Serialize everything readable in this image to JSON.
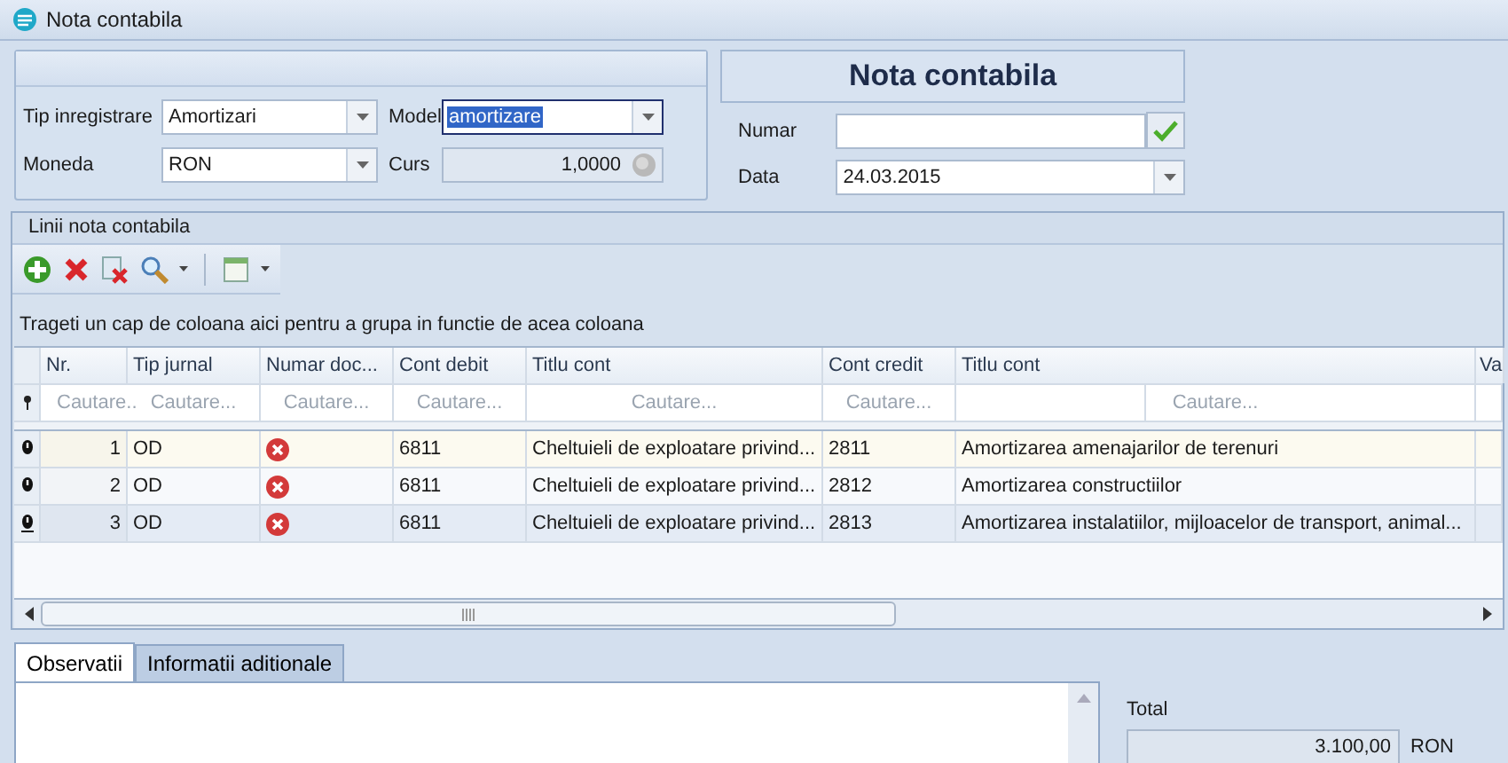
{
  "window": {
    "title": "Nota contabila"
  },
  "header_form": {
    "fields": [
      {
        "label": "Tip inregistrare",
        "value": "Amortizari",
        "kind": "combo",
        "highlighted": false
      },
      {
        "label": "Model",
        "value": "amortizare",
        "kind": "combo",
        "highlighted": true
      },
      {
        "label": "Moneda",
        "value": "RON",
        "kind": "combo",
        "highlighted": false
      },
      {
        "label": "Curs",
        "value": "1,0000",
        "kind": "readonly",
        "highlighted": false
      }
    ]
  },
  "document": {
    "title": "Nota contabila",
    "numar": {
      "label": "Numar"
    },
    "data": {
      "label": "Data",
      "value": "24.03.2015"
    }
  },
  "lines": {
    "caption": "Linii nota contabila",
    "group_hint": "Trageti un cap de coloana aici pentru a grupa in functie de acea coloana",
    "columns": [
      {
        "title": "Nr.",
        "filter": "Cautare.."
      },
      {
        "title": "Tip jurnal",
        "filter": "Cautare..."
      },
      {
        "title": "Numar doc...",
        "filter": "Cautare..."
      },
      {
        "title": "Cont debit",
        "filter": "Cautare..."
      },
      {
        "title": "Titlu cont",
        "filter": "Cautare..."
      },
      {
        "title": "Cont credit",
        "filter": "Cautare..."
      },
      {
        "title": "Titlu cont",
        "filter": "Cautare..."
      },
      {
        "title": "Va"
      }
    ],
    "rows": [
      {
        "nr": "1",
        "jurnal": "OD",
        "doc_error": true,
        "debit": "6811",
        "titlu_debit": "Cheltuieli de exploatare privind...",
        "credit": "2811",
        "titlu_credit": "Amortizarea amenajarilor de terenuri",
        "focused": true,
        "selected": false
      },
      {
        "nr": "2",
        "jurnal": "OD",
        "doc_error": true,
        "debit": "6811",
        "titlu_debit": "Cheltuieli de exploatare privind...",
        "credit": "2812",
        "titlu_credit": "Amortizarea constructiilor",
        "focused": false,
        "selected": false
      },
      {
        "nr": "3",
        "jurnal": "OD",
        "doc_error": true,
        "debit": "6811",
        "titlu_debit": "Cheltuieli de exploatare privind...",
        "credit": "2813",
        "titlu_credit": "Amortizarea instalatiilor, mijloacelor de transport, animal...",
        "focused": false,
        "selected": true
      }
    ]
  },
  "tabs": [
    {
      "label": "Observatii",
      "selected": true
    },
    {
      "label": "Informatii aditionale",
      "selected": false
    }
  ],
  "total": {
    "label": "Total",
    "value": "3.100,00",
    "currency": "RON"
  }
}
